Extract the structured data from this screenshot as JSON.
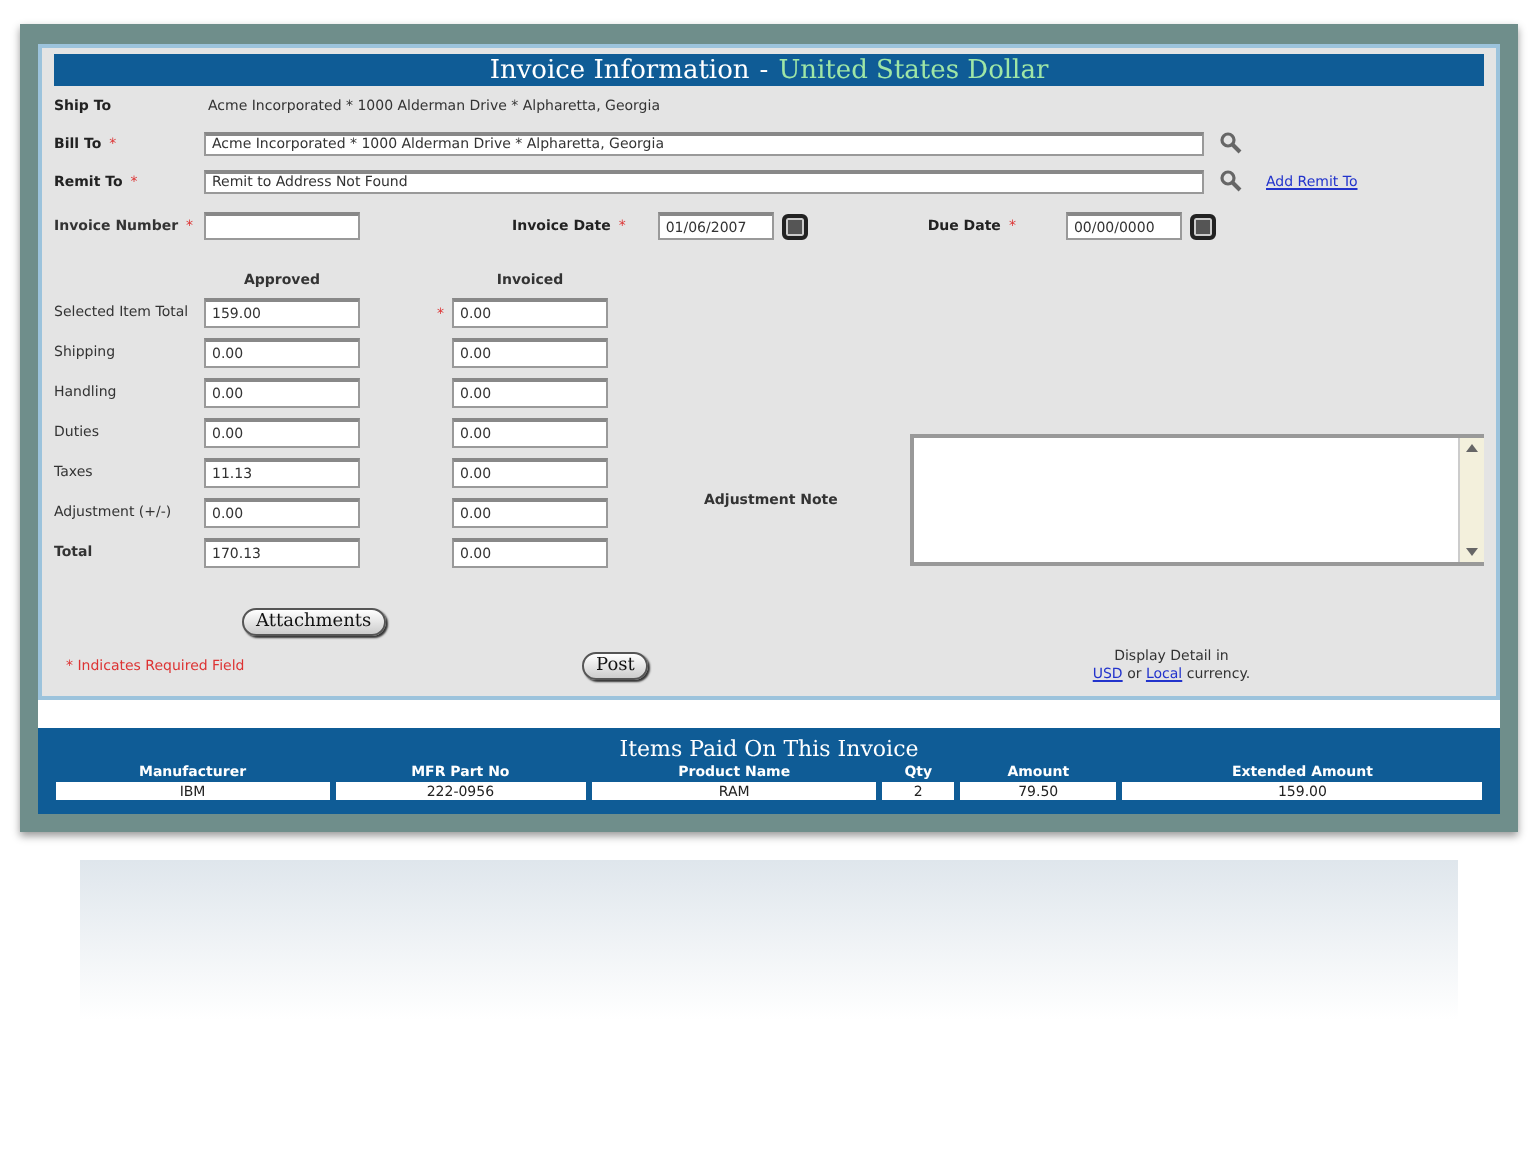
{
  "header": {
    "title": "Invoice Information",
    "separator": "-",
    "currency": "United States Dollar"
  },
  "ship_to": {
    "label": "Ship To",
    "value": "Acme Incorporated * 1000 Alderman Drive * Alpharetta, Georgia"
  },
  "bill_to": {
    "label": "Bill To",
    "required_mark": "*",
    "value": "Acme Incorporated * 1000 Alderman Drive * Alpharetta, Georgia"
  },
  "remit_to": {
    "label": "Remit To",
    "required_mark": "*",
    "value": "Remit to Address Not Found",
    "link": "Add Remit To"
  },
  "invoice_number": {
    "label": "Invoice Number",
    "required_mark": "*"
  },
  "invoice_date": {
    "label": "Invoice Date",
    "required_mark": "*",
    "value": "01/06/2007"
  },
  "due_date": {
    "label": "Due Date",
    "required_mark": "*",
    "value": "00/00/0000"
  },
  "amounts": {
    "columns": [
      "Approved",
      "Invoiced"
    ],
    "rows": [
      {
        "label": "Selected Item Total",
        "approved": "159.00",
        "invoiced": "0.00",
        "required_mark": "*",
        "kind": "line"
      },
      {
        "label": "Shipping",
        "approved": "0.00",
        "invoiced": "0.00",
        "kind": "line"
      },
      {
        "label": "Handling",
        "approved": "0.00",
        "invoiced": "0.00",
        "kind": "line"
      },
      {
        "label": "Duties",
        "approved": "0.00",
        "invoiced": "0.00",
        "kind": "line"
      },
      {
        "label": "Taxes",
        "approved": "11.13",
        "invoiced": "0.00",
        "kind": "line"
      },
      {
        "label": "Adjustment (+/-)",
        "approved": "0.00",
        "invoiced": "0.00",
        "kind": "line"
      },
      {
        "label": "Total",
        "approved": "170.13",
        "invoiced": "0.00",
        "kind": "total"
      }
    ]
  },
  "adjustment_note": {
    "label": "Adjustment Note"
  },
  "buttons": {
    "attachments": "Attachments",
    "post": "Post"
  },
  "required_note": "* Indicates Required Field",
  "display_detail": {
    "text": "Display Detail in",
    "usd": "USD",
    "or": "or",
    "local": "Local",
    "suffix": "currency."
  },
  "items": {
    "title": "Items Paid On This Invoice",
    "columns": [
      "Manufacturer",
      "MFR Part No",
      "Product Name",
      "Qty",
      "Amount",
      "Extended Amount"
    ],
    "rows": [
      [
        "IBM",
        "222-0956",
        "RAM",
        "2",
        "79.50",
        "159.00"
      ]
    ]
  }
}
